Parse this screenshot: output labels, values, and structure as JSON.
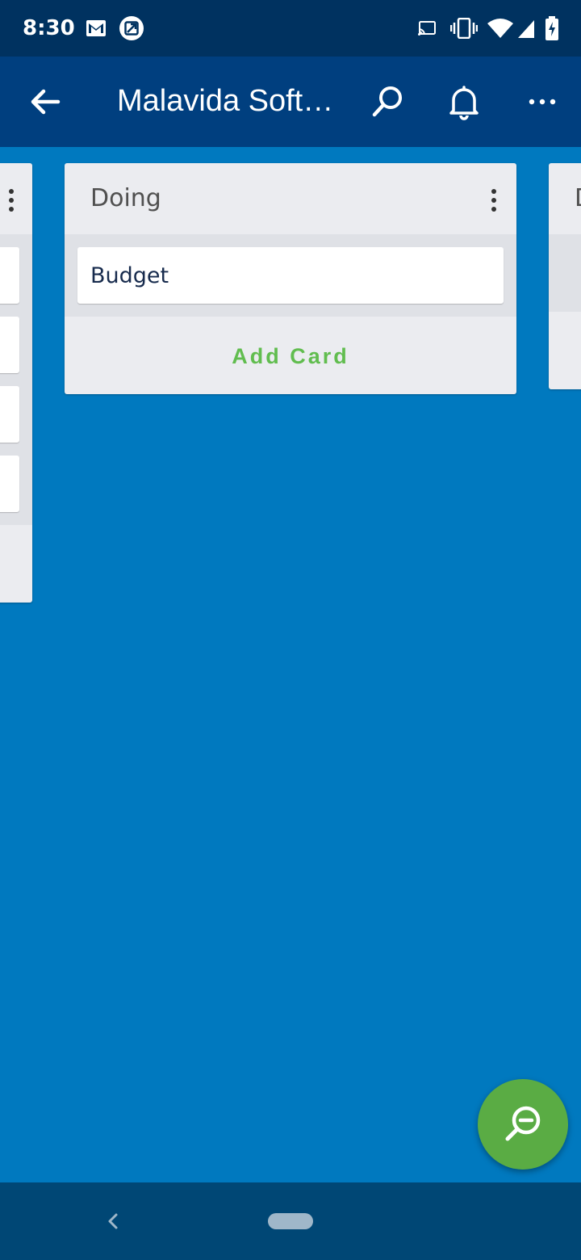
{
  "status_bar": {
    "time": "8:30",
    "left_icons": [
      "gmail-icon",
      "gallery-notification-icon"
    ],
    "right_icons": [
      "cast-icon",
      "vibrate-icon",
      "wifi-icon",
      "signal-icon",
      "battery-charging-icon"
    ]
  },
  "app_bar": {
    "title": "Malavida Soft…",
    "back_icon": "arrow-back-icon",
    "actions": [
      "search-icon",
      "notifications-bell-icon",
      "more-options-icon"
    ]
  },
  "lists": [
    {
      "title": "",
      "partial": "left",
      "cards": [
        "",
        "",
        "",
        ""
      ]
    },
    {
      "title": "Doing",
      "cards": [
        "Budget"
      ],
      "add_card_label": "Add Card"
    },
    {
      "title": "D",
      "partial": "right"
    }
  ],
  "fab": {
    "icon": "zoom-out-icon"
  },
  "colors": {
    "board_background": "#0079bf",
    "app_bar": "#003f7f",
    "status_bar": "#003260",
    "list_background": "#ebecf0",
    "accent_green": "#61bd4f",
    "fab": "#5aac44",
    "nav_bar": "#004775"
  }
}
